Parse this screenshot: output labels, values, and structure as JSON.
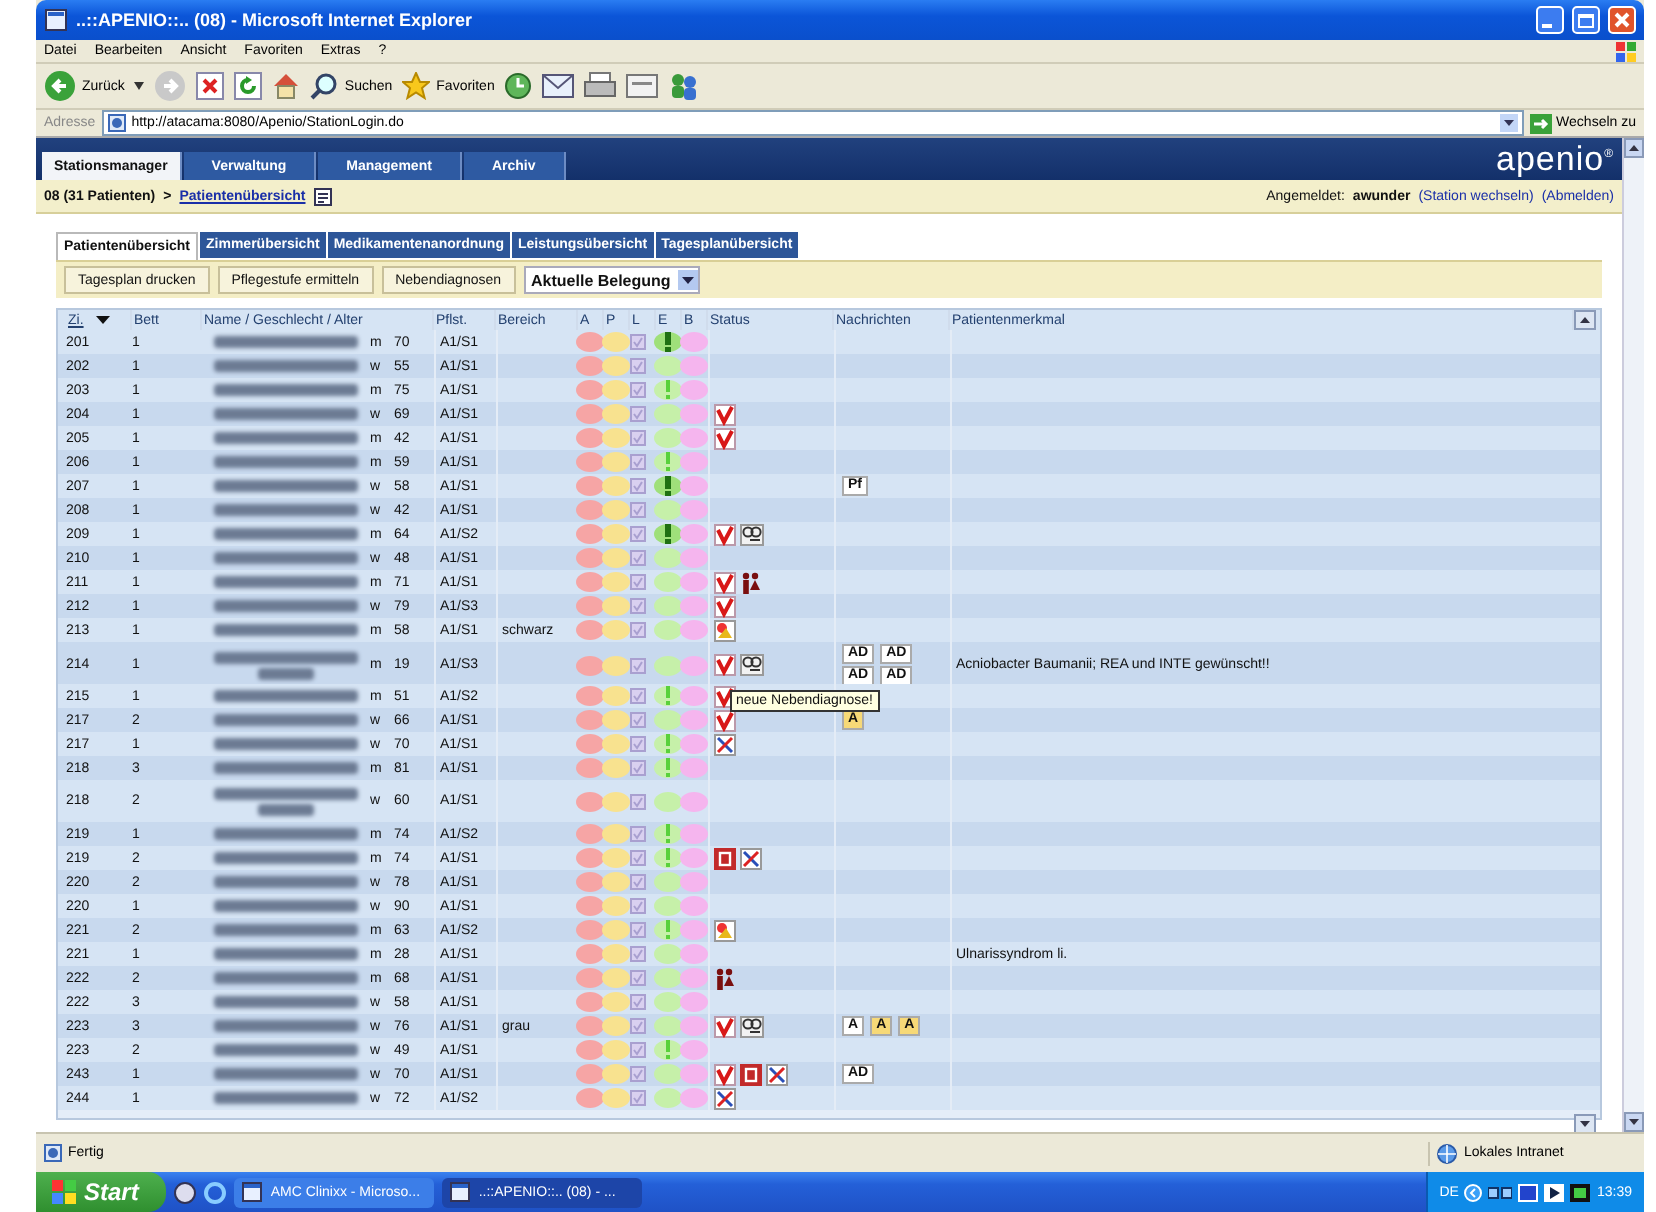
{
  "window": {
    "title": "..::APENIO::.. (08) - Microsoft Internet Explorer"
  },
  "menu": [
    "Datei",
    "Bearbeiten",
    "Ansicht",
    "Favoriten",
    "Extras",
    "?"
  ],
  "toolbar": {
    "back": "Zurück",
    "search": "Suchen",
    "favorites": "Favoriten"
  },
  "address": {
    "label": "Adresse",
    "url": "http://atacama:8080/Apenio/StationLogin.do",
    "go": "Wechseln zu"
  },
  "app": {
    "logo": "apenio$^{®}$",
    "nav": [
      {
        "label": "Stationsmanager",
        "selected": true
      },
      {
        "label": "Verwaltung",
        "selected": false
      },
      {
        "label": "Management",
        "selected": false
      },
      {
        "label": "Archiv",
        "selected": false
      }
    ],
    "breadcrumb": {
      "station": "08 (31 Patienten)",
      "separator": ">",
      "page": "Patientenübersicht"
    },
    "login": {
      "label": "Angemeldet:",
      "user": "awunder",
      "links": [
        "(Station wechseln)",
        "(Abmelden)"
      ]
    },
    "tabs": [
      {
        "label": "Patientenübersicht",
        "selected": true
      },
      {
        "label": "Zimmerübersicht",
        "selected": false
      },
      {
        "label": "Medikamentenanordnung",
        "selected": false
      },
      {
        "label": "Leistungsübersicht",
        "selected": false
      },
      {
        "label": "Tagesplanübersicht",
        "selected": false
      }
    ],
    "actions": [
      "Tagesplan drucken",
      "Pflegestufe ermitteln",
      "Nebendiagnosen"
    ],
    "view_select": {
      "value": "Aktuelle Belegung"
    }
  },
  "table": {
    "columns": [
      {
        "label": "Zi.",
        "sorted": true
      },
      {
        "label": "Bett",
        "sorted": false
      },
      {
        "label": "Name / Geschlecht / Alter",
        "sorted": false
      },
      {
        "label": "Pflst.",
        "sorted": false
      },
      {
        "label": "Bereich",
        "sorted": false
      },
      {
        "label": "A",
        "sorted": false
      },
      {
        "label": "P",
        "sorted": false
      },
      {
        "label": "L",
        "sorted": false
      },
      {
        "label": "E",
        "sorted": false
      },
      {
        "label": "B",
        "sorted": false
      },
      {
        "label": "Status",
        "sorted": false
      },
      {
        "label": "Nachrichten",
        "sorted": false
      },
      {
        "label": "Patientenmerkmal",
        "sorted": false
      }
    ],
    "rows": [
      {
        "room": "201",
        "bed": "1",
        "sex": "m",
        "age": "70",
        "level": "A1/S1",
        "name_wrapped": false,
        "alert": {
          "kind": "major"
        },
        "status": [],
        "messages": []
      },
      {
        "room": "202",
        "bed": "1",
        "sex": "w",
        "age": "55",
        "level": "A1/S1",
        "name_wrapped": false,
        "alert": {
          "kind": "none"
        },
        "status": [],
        "messages": []
      },
      {
        "room": "203",
        "bed": "1",
        "sex": "m",
        "age": "75",
        "level": "A1/S1",
        "name_wrapped": false,
        "alert": {
          "kind": "minor"
        },
        "status": [],
        "messages": []
      },
      {
        "room": "204",
        "bed": "1",
        "sex": "w",
        "age": "69",
        "level": "A1/S1",
        "name_wrapped": false,
        "alert": {
          "kind": "none"
        },
        "status": [
          {
            "kind": "check"
          }
        ],
        "messages": []
      },
      {
        "room": "205",
        "bed": "1",
        "sex": "m",
        "age": "42",
        "level": "A1/S1",
        "name_wrapped": false,
        "alert": {
          "kind": "none"
        },
        "status": [
          {
            "kind": "check"
          }
        ],
        "messages": []
      },
      {
        "room": "206",
        "bed": "1",
        "sex": "m",
        "age": "59",
        "level": "A1/S1",
        "name_wrapped": false,
        "alert": {
          "kind": "minor"
        },
        "status": [],
        "messages": []
      },
      {
        "room": "207",
        "bed": "1",
        "sex": "w",
        "age": "58",
        "level": "A1/S1",
        "name_wrapped": false,
        "alert": {
          "kind": "major"
        },
        "status": [],
        "messages": [
          {
            "text": "Pf",
            "highlighted": false
          }
        ]
      },
      {
        "room": "208",
        "bed": "1",
        "sex": "w",
        "age": "42",
        "level": "A1/S1",
        "name_wrapped": false,
        "alert": {
          "kind": "none"
        },
        "status": [],
        "messages": []
      },
      {
        "room": "209",
        "bed": "1",
        "sex": "m",
        "age": "64",
        "level": "A1/S2",
        "name_wrapped": false,
        "alert": {
          "kind": "major"
        },
        "status": [
          {
            "kind": "check"
          },
          {
            "kind": "magnifier"
          }
        ],
        "messages": []
      },
      {
        "room": "210",
        "bed": "1",
        "sex": "w",
        "age": "48",
        "level": "A1/S1",
        "name_wrapped": false,
        "alert": {
          "kind": "none"
        },
        "status": [],
        "messages": []
      },
      {
        "room": "211",
        "bed": "1",
        "sex": "m",
        "age": "71",
        "level": "A1/S1",
        "name_wrapped": false,
        "alert": {
          "kind": "none"
        },
        "status": [
          {
            "kind": "check"
          },
          {
            "kind": "figures"
          }
        ],
        "messages": []
      },
      {
        "room": "212",
        "bed": "1",
        "sex": "w",
        "age": "79",
        "level": "A1/S3",
        "name_wrapped": false,
        "alert": {
          "kind": "none"
        },
        "status": [
          {
            "kind": "check"
          }
        ],
        "messages": []
      },
      {
        "room": "213",
        "bed": "1",
        "sex": "m",
        "age": "58",
        "level": "A1/S1",
        "area": "schwarz",
        "name_wrapped": false,
        "alert": {
          "kind": "none"
        },
        "status": [
          {
            "kind": "picture"
          }
        ],
        "messages": []
      },
      {
        "room": "214",
        "bed": "1",
        "sex": "m",
        "age": "19",
        "level": "A1/S3",
        "name_wrapped": true,
        "alert": {
          "kind": "none"
        },
        "status": [
          {
            "kind": "check"
          },
          {
            "kind": "magnifier"
          }
        ],
        "messages": [
          {
            "text": "AD",
            "highlighted": false
          },
          {
            "text": "AD",
            "highlighted": false
          },
          {
            "text": "AD",
            "highlighted": false
          },
          {
            "text": "AD",
            "highlighted": false
          }
        ],
        "note": "Acniobacter Baumanii; REA und INTE gewünscht!!",
        "tooltip": "neue Nebendiagnose!"
      },
      {
        "room": "215",
        "bed": "1",
        "sex": "m",
        "age": "51",
        "level": "A1/S2",
        "name_wrapped": false,
        "alert": {
          "kind": "minor"
        },
        "status": [
          {
            "kind": "check"
          }
        ],
        "messages": []
      },
      {
        "room": "217",
        "bed": "2",
        "sex": "w",
        "age": "66",
        "level": "A1/S1",
        "name_wrapped": false,
        "alert": {
          "kind": "none"
        },
        "status": [
          {
            "kind": "check"
          }
        ],
        "messages": [
          {
            "text": "A",
            "highlighted": true
          }
        ]
      },
      {
        "room": "217",
        "bed": "1",
        "sex": "w",
        "age": "70",
        "level": "A1/S1",
        "name_wrapped": false,
        "alert": {
          "kind": "minor"
        },
        "status": [
          {
            "kind": "cross"
          }
        ],
        "messages": []
      },
      {
        "room": "218",
        "bed": "3",
        "sex": "m",
        "age": "81",
        "level": "A1/S1",
        "name_wrapped": false,
        "alert": {
          "kind": "minor"
        },
        "status": [],
        "messages": []
      },
      {
        "room": "218",
        "bed": "2",
        "sex": "w",
        "age": "60",
        "level": "A1/S1",
        "name_wrapped": true,
        "alert": {
          "kind": "none"
        },
        "status": [],
        "messages": []
      },
      {
        "room": "219",
        "bed": "1",
        "sex": "m",
        "age": "74",
        "level": "A1/S2",
        "name_wrapped": false,
        "alert": {
          "kind": "minor"
        },
        "status": [],
        "messages": []
      },
      {
        "room": "219",
        "bed": "2",
        "sex": "m",
        "age": "74",
        "level": "A1/S1",
        "name_wrapped": false,
        "alert": {
          "kind": "minor"
        },
        "status": [
          {
            "kind": "tag"
          },
          {
            "kind": "cross"
          }
        ],
        "messages": []
      },
      {
        "room": "220",
        "bed": "2",
        "sex": "w",
        "age": "78",
        "level": "A1/S1",
        "name_wrapped": false,
        "alert": {
          "kind": "none"
        },
        "status": [],
        "messages": []
      },
      {
        "room": "220",
        "bed": "1",
        "sex": "w",
        "age": "90",
        "level": "A1/S1",
        "name_wrapped": false,
        "alert": {
          "kind": "none"
        },
        "status": [],
        "messages": []
      },
      {
        "room": "221",
        "bed": "2",
        "sex": "m",
        "age": "63",
        "level": "A1/S2",
        "name_wrapped": false,
        "alert": {
          "kind": "minor"
        },
        "status": [
          {
            "kind": "picture"
          }
        ],
        "messages": []
      },
      {
        "room": "221",
        "bed": "1",
        "sex": "m",
        "age": "28",
        "level": "A1/S1",
        "name_wrapped": false,
        "alert": {
          "kind": "none"
        },
        "status": [],
        "messages": [],
        "note": "Ulnarissyndrom li."
      },
      {
        "room": "222",
        "bed": "2",
        "sex": "m",
        "age": "68",
        "level": "A1/S1",
        "name_wrapped": false,
        "alert": {
          "kind": "none"
        },
        "status": [
          {
            "kind": "figures"
          }
        ],
        "messages": []
      },
      {
        "room": "222",
        "bed": "3",
        "sex": "w",
        "age": "58",
        "level": "A1/S1",
        "name_wrapped": false,
        "alert": {
          "kind": "none"
        },
        "status": [],
        "messages": []
      },
      {
        "room": "223",
        "bed": "3",
        "sex": "w",
        "age": "76",
        "level": "A1/S1",
        "area": "grau",
        "name_wrapped": false,
        "alert": {
          "kind": "none"
        },
        "status": [
          {
            "kind": "check"
          },
          {
            "kind": "magnifier"
          }
        ],
        "messages": [
          {
            "text": "A",
            "highlighted": false
          },
          {
            "text": "A",
            "highlighted": true
          },
          {
            "text": "A",
            "highlighted": true
          }
        ]
      },
      {
        "room": "223",
        "bed": "2",
        "sex": "w",
        "age": "49",
        "level": "A1/S1",
        "name_wrapped": false,
        "alert": {
          "kind": "minor"
        },
        "status": [],
        "messages": []
      },
      {
        "room": "243",
        "bed": "1",
        "sex": "w",
        "age": "70",
        "level": "A1/S1",
        "name_wrapped": false,
        "alert": {
          "kind": "none"
        },
        "status": [
          {
            "kind": "check"
          },
          {
            "kind": "tag"
          },
          {
            "kind": "cross"
          }
        ],
        "messages": [
          {
            "text": "AD",
            "highlighted": false
          }
        ]
      },
      {
        "room": "244",
        "bed": "1",
        "sex": "w",
        "age": "72",
        "level": "A1/S2",
        "name_wrapped": false,
        "alert": {
          "kind": "none"
        },
        "status": [
          {
            "kind": "cross"
          }
        ],
        "messages": []
      }
    ]
  },
  "status_bar": {
    "text": "Fertig",
    "zone": "Lokales Intranet"
  },
  "taskbar": {
    "start": "Start",
    "tasks": [
      {
        "label": "AMC Clinixx - Microso...",
        "selected": false
      },
      {
        "label": "..::APENIO::.. (08) - ...",
        "selected": true
      }
    ],
    "lang": "DE",
    "clock": "13:39"
  }
}
